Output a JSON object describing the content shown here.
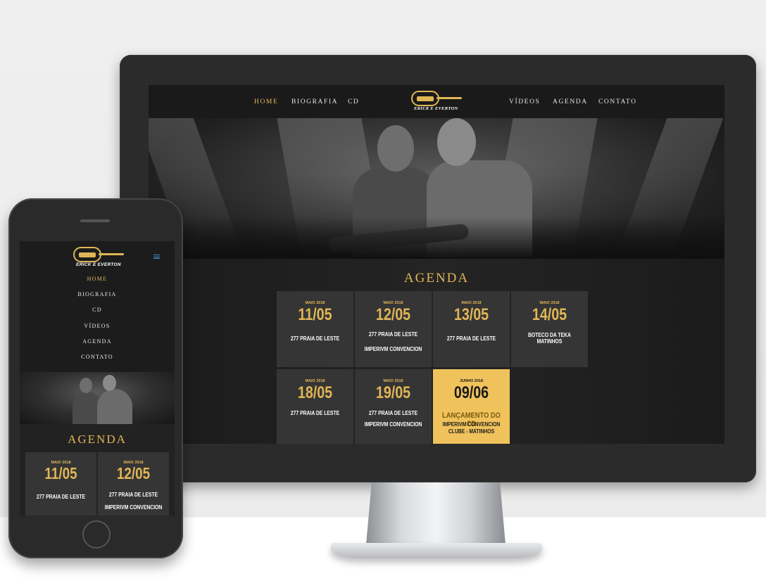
{
  "desktop": {
    "nav": {
      "left": [
        "HOME",
        "BIOGRAFIA",
        "CD"
      ],
      "right": [
        "VÍDEOS",
        "AGENDA",
        "CONTATO"
      ],
      "active": "HOME"
    },
    "logo_text": "ERICK E EVERTON",
    "agenda_title": "AGENDA",
    "events": [
      {
        "month": "MAIO 2018",
        "day": "11/05",
        "line1": "277 PRAIA DE LESTE",
        "line2": ""
      },
      {
        "month": "MAIO 2018",
        "day": "12/05",
        "line1": "277 PRAIA DE LESTE",
        "line2": "IMPERIVM CONVENCION"
      },
      {
        "month": "MAIO 2018",
        "day": "13/05",
        "line1": "277 PRAIA DE LESTE",
        "line2": ""
      },
      {
        "month": "MAIO 2018",
        "day": "14/05",
        "line1": "BOTECO DA TEKA",
        "line2": "MATINHOS"
      },
      {
        "month": "MAIO 2018",
        "day": "18/05",
        "line1": "277 PRAIA DE LESTE",
        "line2": ""
      },
      {
        "month": "MAIO 2018",
        "day": "19/05",
        "line1": "277 PRAIA DE LESTE",
        "line2": "IMPERIVM CONVENCION"
      },
      {
        "month": "JUNHO 2018",
        "day": "09/06",
        "line1": "LANÇAMENTO DO CD",
        "line2": "IMPERIVM CONVENCION",
        "line3": "CLUBE - MATINHOS",
        "highlight": true
      }
    ]
  },
  "mobile": {
    "logo_text": "ERICK E EVERTON",
    "menu": [
      "HOME",
      "BIOGRAFIA",
      "CD",
      "VÍDEOS",
      "AGENDA",
      "CONTATO"
    ],
    "active": "HOME",
    "agenda_title": "AGENDA",
    "events": [
      {
        "month": "MAIO 2018",
        "day": "11/05",
        "line1": "277 PRAIA DE LESTE",
        "line2": ""
      },
      {
        "month": "MAIO 2018",
        "day": "12/05",
        "line1": "277 PRAIA DE LESTE",
        "line2": "IMPERIVM CONVENCION"
      }
    ]
  },
  "colors": {
    "accent": "#e0b656",
    "highlight_tile": "#f0c25c",
    "tile": "#353535",
    "background": "#151515"
  }
}
